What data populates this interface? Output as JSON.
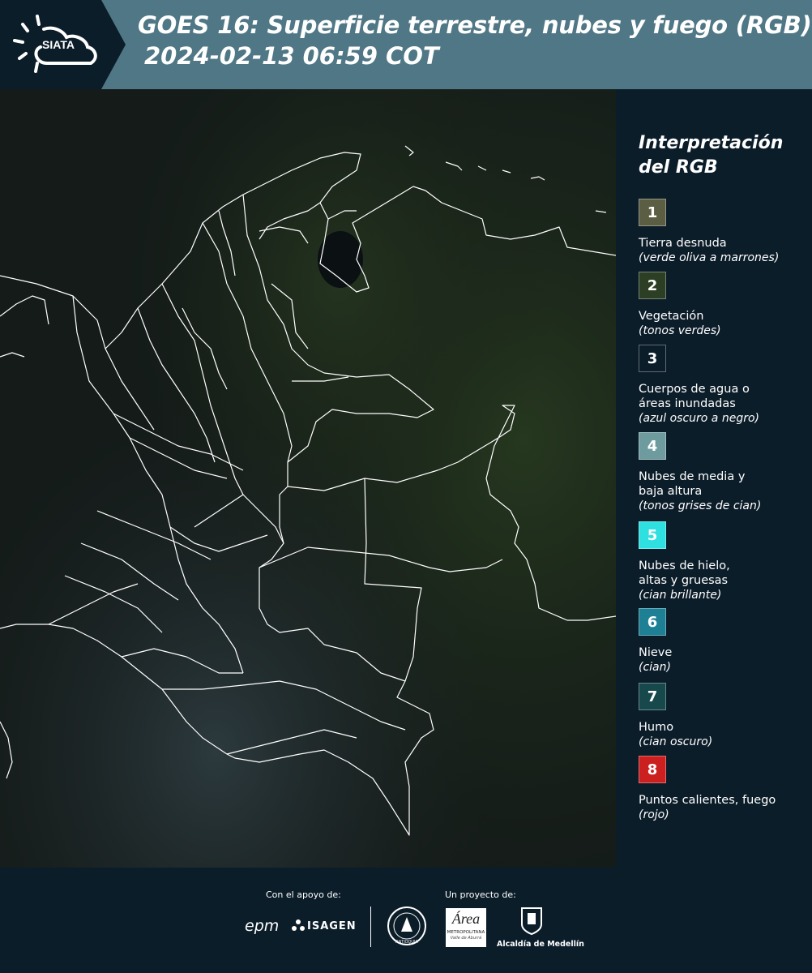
{
  "header": {
    "title": "GOES 16: Superficie terrestre, nubes y fuego (RGB)",
    "datetime": "2024-02-13 06:59 COT",
    "logo_text": "SIATA"
  },
  "legend": {
    "title": "Interpretación del RGB",
    "items": [
      {
        "number": "1",
        "label": "Tierra desnuda",
        "note": "(verde oliva a marrones)",
        "color": "#5c5e44"
      },
      {
        "number": "2",
        "label": "Vegetación",
        "note": "(tonos verdes)",
        "color": "#2c3f24"
      },
      {
        "number": "3",
        "label": "Cuerpos de agua o áreas inundadas",
        "note": "(azul oscuro a negro)",
        "color": "#0c1d2a"
      },
      {
        "number": "4",
        "label": "Nubes de media y baja altura",
        "note": "(tonos grises de cian)",
        "color": "#6e9c9e"
      },
      {
        "number": "5",
        "label": "Nubes de hielo, altas y gruesas",
        "note": "(cian brillante)",
        "color": "#2ee0e0"
      },
      {
        "number": "6",
        "label": "Nieve",
        "note": "(cian)",
        "color": "#1e8095"
      },
      {
        "number": "7",
        "label": "Humo",
        "note": "(cian oscuro)",
        "color": "#17494c"
      },
      {
        "number": "8",
        "label": "Puntos calientes, fuego",
        "note": "(rojo)",
        "color": "#cc1f1f"
      }
    ]
  },
  "footer": {
    "support_label": "Con el apoyo de:",
    "project_label": "Un proyecto de:",
    "sponsor_epm": "epm",
    "sponsor_isagen": "ISAGEN",
    "sponsor_area": "Área",
    "sponsor_area_sub": "METROPOLITANA",
    "sponsor_area_sub2": "Valle de Aburrá",
    "sponsor_alcaldia": "Alcaldía de Medellín",
    "sponsor_antioquia": "ANTIOQUIA"
  },
  "colors": {
    "header_bg": "#4f7785",
    "panel_bg": "#0c1d2a",
    "border_color": "#ffffff"
  }
}
